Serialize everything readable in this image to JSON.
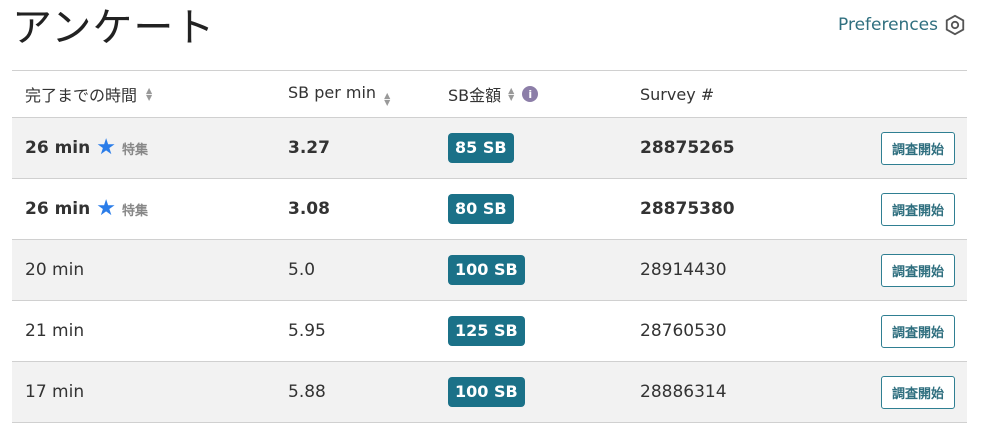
{
  "page": {
    "title": "アンケート",
    "preferences_label": "Preferences"
  },
  "table": {
    "headers": {
      "time": "完了までの時間",
      "sb_per_min": "SB per min",
      "sb_amount": "SB金額",
      "survey_no": "Survey #"
    },
    "rows": [
      {
        "time": "26 min",
        "featured": true,
        "tag": "特集",
        "sb_per_min": "3.27",
        "sb": "85 SB",
        "survey": "28875265",
        "button": "調査開始"
      },
      {
        "time": "26 min",
        "featured": true,
        "tag": "特集",
        "sb_per_min": "3.08",
        "sb": "80 SB",
        "survey": "28875380",
        "button": "調査開始"
      },
      {
        "time": "20 min",
        "featured": false,
        "tag": "",
        "sb_per_min": "5.0",
        "sb": "100 SB",
        "survey": "28914430",
        "button": "調査開始"
      },
      {
        "time": "21 min",
        "featured": false,
        "tag": "",
        "sb_per_min": "5.95",
        "sb": "125 SB",
        "survey": "28760530",
        "button": "調査開始"
      },
      {
        "time": "17 min",
        "featured": false,
        "tag": "",
        "sb_per_min": "5.88",
        "sb": "100 SB",
        "survey": "28886314",
        "button": "調査開始"
      }
    ]
  },
  "icons": {
    "preferences": "gear-hexagon-icon",
    "sort": "sort-arrows-icon",
    "info": "info-icon",
    "featured": "star-icon"
  },
  "colors": {
    "accent": "#1b7188",
    "link": "#2f6f7f",
    "star": "#2b7de9",
    "row_shaded": "#f2f2f2"
  }
}
